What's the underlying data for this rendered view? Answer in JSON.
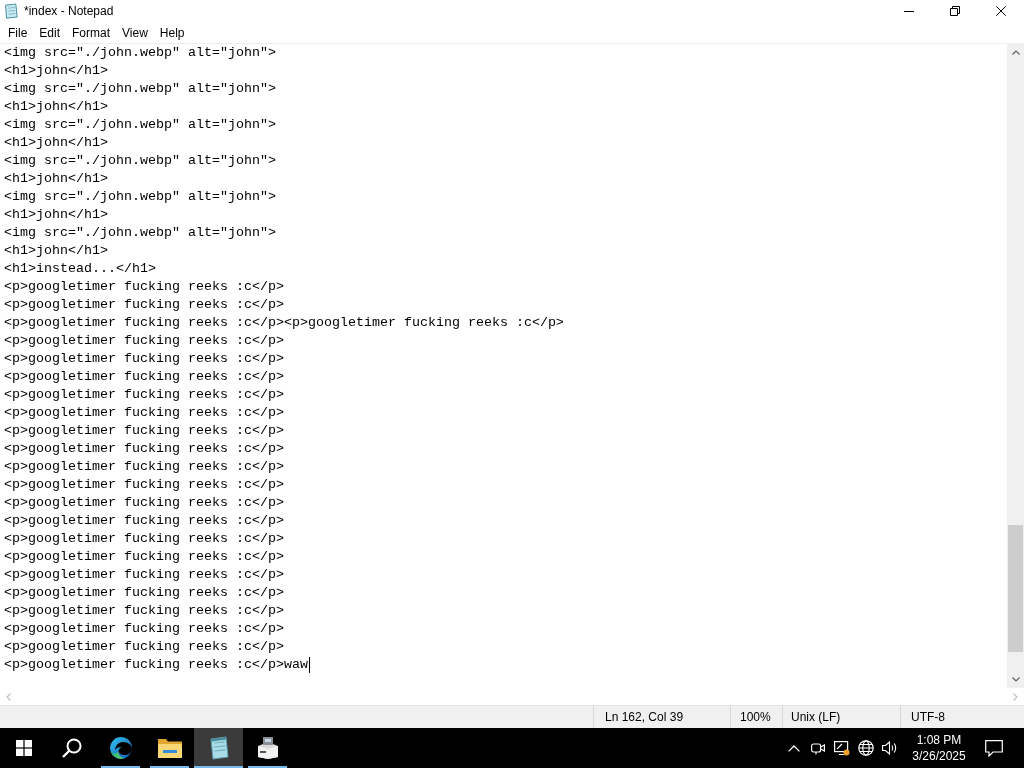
{
  "window": {
    "title": "*index - Notepad"
  },
  "menu": [
    "File",
    "Edit",
    "Format",
    "View",
    "Help"
  ],
  "editor": {
    "lines": [
      {
        "text": "<img src=\"./john.webp\" alt=\"john\">",
        "caret": false
      },
      {
        "text": "<h1>john</h1>",
        "caret": false
      },
      {
        "text": "<img src=\"./john.webp\" alt=\"john\">",
        "caret": false
      },
      {
        "text": "<h1>john</h1>",
        "caret": false
      },
      {
        "text": "<img src=\"./john.webp\" alt=\"john\">",
        "caret": false
      },
      {
        "text": "<h1>john</h1>",
        "caret": false
      },
      {
        "text": "<img src=\"./john.webp\" alt=\"john\">",
        "caret": false
      },
      {
        "text": "<h1>john</h1>",
        "caret": false
      },
      {
        "text": "<img src=\"./john.webp\" alt=\"john\">",
        "caret": false
      },
      {
        "text": "<h1>john</h1>",
        "caret": false
      },
      {
        "text": "<img src=\"./john.webp\" alt=\"john\">",
        "caret": false
      },
      {
        "text": "<h1>john</h1>",
        "caret": false
      },
      {
        "text": "<h1>instead...</h1>",
        "caret": false
      },
      {
        "text": "<p>googletimer fucking reeks :c</p>",
        "caret": false
      },
      {
        "text": "<p>googletimer fucking reeks :c</p>",
        "caret": false
      },
      {
        "text": "<p>googletimer fucking reeks :c</p><p>googletimer fucking reeks :c</p>",
        "caret": false
      },
      {
        "text": "<p>googletimer fucking reeks :c</p>",
        "caret": false
      },
      {
        "text": "<p>googletimer fucking reeks :c</p>",
        "caret": false
      },
      {
        "text": "<p>googletimer fucking reeks :c</p>",
        "caret": false
      },
      {
        "text": "<p>googletimer fucking reeks :c</p>",
        "caret": false
      },
      {
        "text": "<p>googletimer fucking reeks :c</p>",
        "caret": false
      },
      {
        "text": "<p>googletimer fucking reeks :c</p>",
        "caret": false
      },
      {
        "text": "<p>googletimer fucking reeks :c</p>",
        "caret": false
      },
      {
        "text": "<p>googletimer fucking reeks :c</p>",
        "caret": false
      },
      {
        "text": "<p>googletimer fucking reeks :c</p>",
        "caret": false
      },
      {
        "text": "<p>googletimer fucking reeks :c</p>",
        "caret": false
      },
      {
        "text": "<p>googletimer fucking reeks :c</p>",
        "caret": false
      },
      {
        "text": "<p>googletimer fucking reeks :c</p>",
        "caret": false
      },
      {
        "text": "<p>googletimer fucking reeks :c</p>",
        "caret": false
      },
      {
        "text": "<p>googletimer fucking reeks :c</p>",
        "caret": false
      },
      {
        "text": "<p>googletimer fucking reeks :c</p>",
        "caret": false
      },
      {
        "text": "<p>googletimer fucking reeks :c</p>",
        "caret": false
      },
      {
        "text": "<p>googletimer fucking reeks :c</p>",
        "caret": false
      },
      {
        "text": "<p>googletimer fucking reeks :c</p>",
        "caret": false
      },
      {
        "text": "<p>googletimer fucking reeks :c</p>waw",
        "caret": true
      }
    ]
  },
  "status_bar": {
    "position": "Ln 162, Col 39",
    "zoom": "100%",
    "line_ending": "Unix (LF)",
    "encoding": "UTF-8"
  },
  "taskbar": {
    "apps": [
      {
        "kind": "browser",
        "running": true,
        "selected": false
      },
      {
        "kind": "folder",
        "running": true,
        "selected": false
      },
      {
        "kind": "notepad",
        "running": true,
        "selected": true
      },
      {
        "kind": "printer",
        "running": true,
        "selected": false
      }
    ],
    "clock": {
      "time": "1:08 PM",
      "date": "3/26/2025"
    }
  }
}
